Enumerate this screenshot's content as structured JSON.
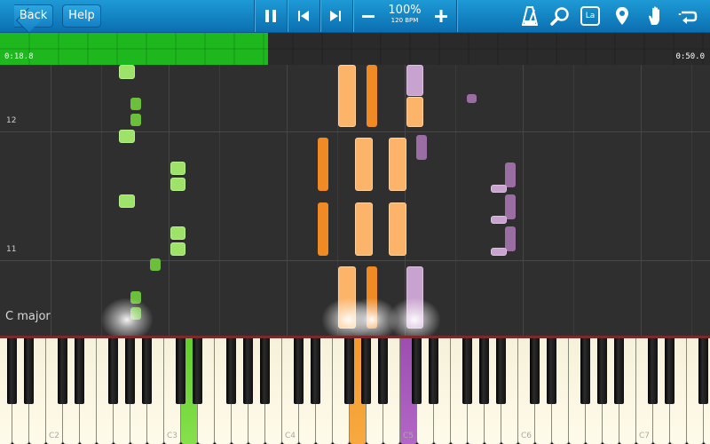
{
  "toolbar": {
    "back_label": "Back",
    "help_label": "Help",
    "zoom_percent": "100%",
    "tempo": "120 BPM",
    "icons": [
      "pause-icon",
      "skip-back-icon",
      "skip-forward-icon",
      "minus-icon",
      "plus-icon",
      "metronome-icon",
      "magnifier-icon",
      "label-la-icon",
      "location-pin-icon",
      "hand-icon",
      "loop-icon"
    ],
    "label_icon_text": "La"
  },
  "progress": {
    "current_time": "0:18.8",
    "total_time": "0:50.0",
    "fraction": 0.377,
    "color": "#1eb81e"
  },
  "roll": {
    "measure_labels": [
      {
        "text": "12"
      },
      {
        "text": "11"
      }
    ],
    "key_signature": "C major"
  },
  "keyboard": {
    "octave_labels": [
      "C2",
      "C3",
      "C4",
      "C5",
      "C6",
      "C7"
    ],
    "active_keys": [
      {
        "note": "D3",
        "color": "green"
      },
      {
        "note": "C5",
        "color": "purple"
      },
      {
        "note": "G4",
        "color": "orange"
      }
    ]
  },
  "colors": {
    "toolbar": "#1485c8",
    "green": "#9ee26a",
    "orange": "#fbb46a",
    "purple": "#c9a3cf"
  }
}
